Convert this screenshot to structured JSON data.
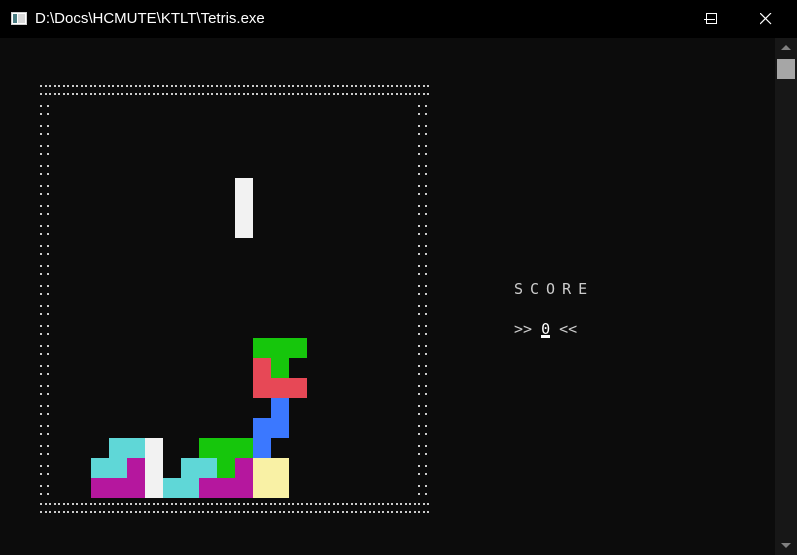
{
  "window": {
    "title": "D:\\Docs\\HCMUTE\\KTLT\\Tetris.exe",
    "controls": [
      "minimize",
      "maximize",
      "close"
    ]
  },
  "game": {
    "border_char": ":",
    "colors": {
      "cyan": "#5fd7d7",
      "white": "#f2f2f2",
      "magenta": "#b5179e",
      "green": "#16c60c",
      "red": "#e74856",
      "blue": "#3b78ff",
      "yellow": "#f9f1a5"
    },
    "cells": [
      {
        "col": 1,
        "row": 2,
        "color": "white"
      },
      {
        "col": 1,
        "row": 3,
        "color": "white"
      },
      {
        "col": 1,
        "row": 4,
        "color": "white"
      },
      {
        "col": 2,
        "row": 10,
        "color": "green"
      },
      {
        "col": 3,
        "row": 10,
        "color": "green"
      },
      {
        "col": 4,
        "row": 10,
        "color": "green"
      },
      {
        "col": 2,
        "row": 11,
        "color": "red"
      },
      {
        "col": 3,
        "row": 11,
        "color": "green"
      },
      {
        "col": 2,
        "row": 12,
        "color": "red"
      },
      {
        "col": 3,
        "row": 12,
        "color": "red"
      },
      {
        "col": 4,
        "row": 12,
        "color": "red"
      },
      {
        "col": 3,
        "row": 13,
        "color": "blue"
      },
      {
        "col": 2,
        "row": 14,
        "color": "blue"
      },
      {
        "col": 3,
        "row": 14,
        "color": "blue"
      },
      {
        "col": 2,
        "row": 15,
        "color": "blue"
      },
      {
        "col": 2,
        "row": 16,
        "color": "yellow"
      },
      {
        "col": 3,
        "row": 16,
        "color": "yellow"
      },
      {
        "col": 2,
        "row": 17,
        "color": "yellow"
      },
      {
        "col": 3,
        "row": 17,
        "color": "yellow"
      },
      {
        "col": -6,
        "row": 15,
        "color": "cyan"
      },
      {
        "col": -5,
        "row": 15,
        "color": "cyan"
      },
      {
        "col": -4,
        "row": 15,
        "color": "white"
      },
      {
        "col": -1,
        "row": 15,
        "color": "green"
      },
      {
        "col": 0,
        "row": 15,
        "color": "green"
      },
      {
        "col": 1,
        "row": 15,
        "color": "green"
      },
      {
        "col": -7,
        "row": 16,
        "color": "cyan"
      },
      {
        "col": -6,
        "row": 16,
        "color": "cyan"
      },
      {
        "col": -5,
        "row": 16,
        "color": "magenta"
      },
      {
        "col": -4,
        "row": 16,
        "color": "white"
      },
      {
        "col": -2,
        "row": 16,
        "color": "cyan"
      },
      {
        "col": -1,
        "row": 16,
        "color": "cyan"
      },
      {
        "col": 0,
        "row": 16,
        "color": "green"
      },
      {
        "col": 1,
        "row": 16,
        "color": "magenta"
      },
      {
        "col": -7,
        "row": 17,
        "color": "magenta"
      },
      {
        "col": -6,
        "row": 17,
        "color": "magenta"
      },
      {
        "col": -5,
        "row": 17,
        "color": "magenta"
      },
      {
        "col": -4,
        "row": 17,
        "color": "white"
      },
      {
        "col": -3,
        "row": 17,
        "color": "cyan"
      },
      {
        "col": -2,
        "row": 17,
        "color": "cyan"
      },
      {
        "col": -1,
        "row": 17,
        "color": "magenta"
      },
      {
        "col": 0,
        "row": 17,
        "color": "magenta"
      },
      {
        "col": 1,
        "row": 17,
        "color": "magenta"
      }
    ]
  },
  "score": {
    "label": "SCORE",
    "prefix": ">> ",
    "value": "0",
    "suffix": " <<"
  }
}
